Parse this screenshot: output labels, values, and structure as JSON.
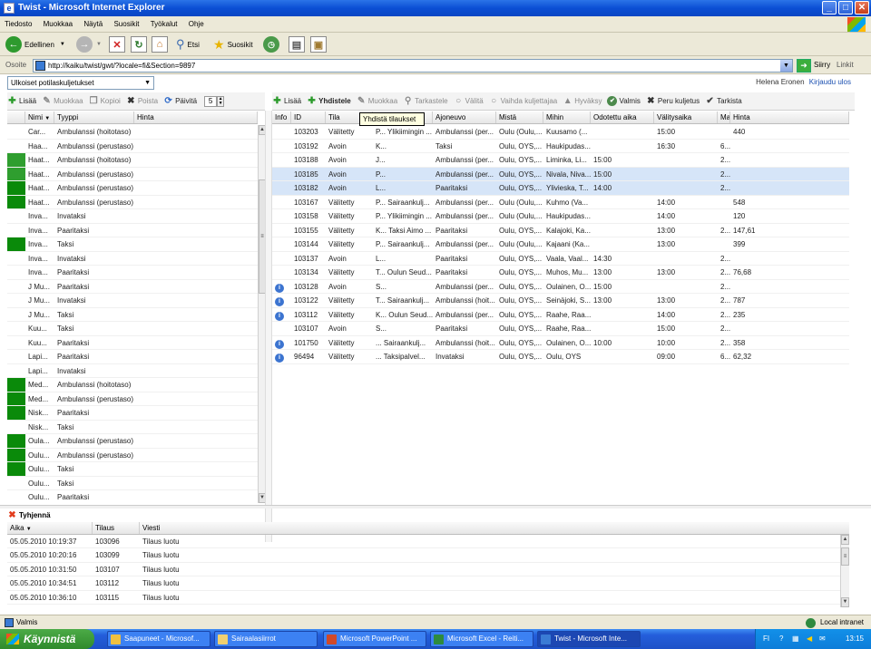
{
  "window": {
    "title": "Twist - Microsoft Internet Explorer",
    "btn_min": "_",
    "btn_max": "□",
    "btn_close": "✕"
  },
  "menu": [
    "Tiedosto",
    "Muokkaa",
    "Näytä",
    "Suosikit",
    "Työkalut",
    "Ohje"
  ],
  "ie_toolbar": {
    "back": "Edellinen",
    "search": "Etsi",
    "favorites": "Suosikit"
  },
  "address": {
    "label": "Osoite",
    "url": "http://kaiku/twist/gwt/?locale=fi&Section=9897",
    "go": "Siirry",
    "links": "Linkit"
  },
  "app": {
    "view_select": "Ulkoiset potilaskuljetukset",
    "user_name": "Helena Eronen",
    "logout": "Kirjaudu ulos",
    "left_toolbar": {
      "add": "Lisää",
      "edit": "Muokkaa",
      "copy": "Kopioi",
      "delete": "Poista",
      "refresh": "Päivitä",
      "refresh_value": "5"
    },
    "right_toolbar": {
      "add": "Lisää",
      "merge": "Yhdistele",
      "edit": "Muokkaa",
      "check": "Tarkastele",
      "broker": "Välitä",
      "change_carrier": "Vaihda kuljettajaa",
      "accept": "Hyväksy",
      "done": "Valmis",
      "cancel": "Peru kuljetus",
      "review": "Tarkista"
    },
    "tooltip": "Yhdistä tilaukset",
    "left_columns": [
      "Nimi",
      "Tyyppi",
      "Hinta"
    ],
    "left_rows": [
      {
        "color": "",
        "name": "Car...",
        "type": "Ambulanssi (hoitotaso)"
      },
      {
        "color": "",
        "name": "Haa...",
        "type": "Ambulanssi (perustaso)"
      },
      {
        "color": "#2f9e2f",
        "name": "Haat...",
        "type": "Ambulanssi (hoitotaso)"
      },
      {
        "color": "#2f9e2f",
        "name": "Haat...",
        "type": "Ambulanssi (perustaso)"
      },
      {
        "color": "#0a8a0a",
        "name": "Haat...",
        "type": "Ambulanssi (perustaso)"
      },
      {
        "color": "#0a8a0a",
        "name": "Haat...",
        "type": "Ambulanssi (perustaso)"
      },
      {
        "color": "",
        "name": "Inva...",
        "type": "Invataksi"
      },
      {
        "color": "",
        "name": "Inva...",
        "type": "Paaritaksi"
      },
      {
        "color": "#0a8a0a",
        "name": "Inva...",
        "type": "Taksi"
      },
      {
        "color": "",
        "name": "Inva...",
        "type": "Invataksi"
      },
      {
        "color": "",
        "name": "Inva...",
        "type": "Paaritaksi"
      },
      {
        "color": "",
        "name": "J Mu...",
        "type": "Paaritaksi"
      },
      {
        "color": "",
        "name": "J Mu...",
        "type": "Invataksi"
      },
      {
        "color": "",
        "name": "J Mu...",
        "type": "Taksi"
      },
      {
        "color": "",
        "name": "Kuu...",
        "type": "Taksi"
      },
      {
        "color": "",
        "name": "Kuu...",
        "type": "Paaritaksi"
      },
      {
        "color": "",
        "name": "Lapi...",
        "type": "Paaritaksi"
      },
      {
        "color": "",
        "name": "Lapi...",
        "type": "Invataksi"
      },
      {
        "color": "#0a8a0a",
        "name": "Med...",
        "type": "Ambulanssi (hoitotaso)"
      },
      {
        "color": "#0a8a0a",
        "name": "Med...",
        "type": "Ambulanssi (perustaso)"
      },
      {
        "color": "#0a8a0a",
        "name": "Nisk...",
        "type": "Paaritaksi"
      },
      {
        "color": "",
        "name": "Nisk...",
        "type": "Taksi"
      },
      {
        "color": "#0a8a0a",
        "name": "Oula...",
        "type": "Ambulanssi (perustaso)"
      },
      {
        "color": "#0a8a0a",
        "name": "Oulu...",
        "type": "Ambulanssi (perustaso)"
      },
      {
        "color": "#0a8a0a",
        "name": "Oulu...",
        "type": "Taksi"
      },
      {
        "color": "",
        "name": "Oulu...",
        "type": "Taksi"
      },
      {
        "color": "",
        "name": "Oulu...",
        "type": "Paaritaksi"
      }
    ],
    "right_columns": [
      "Info",
      "ID",
      "Tila",
      "",
      "Ajoneuvo",
      "Mistä",
      "Mihin",
      "Odotettu aika",
      "Välitysaika",
      "Ma",
      "Hinta"
    ],
    "right_rows": [
      {
        "info": "",
        "id": "103203",
        "state": "Välitetty",
        "carrier": "P... Ylikiimingin ...",
        "vehicle": "Ambulanssi (per...",
        "from": "Oulu (Oulu,...",
        "to": "Kuusamo (...",
        "expected": "",
        "dispatch": "15:00",
        "ma": "",
        "price": "440",
        "sel": false
      },
      {
        "info": "",
        "id": "103192",
        "state": "Avoin",
        "carrier": "K...",
        "vehicle": "Taksi",
        "from": "Oulu, OYS,...",
        "to": "Haukipudas...",
        "expected": "",
        "dispatch": "16:30",
        "ma": "6...",
        "price": "",
        "sel": false
      },
      {
        "info": "",
        "id": "103188",
        "state": "Avoin",
        "carrier": "J...",
        "vehicle": "Ambulanssi (per...",
        "from": "Oulu, OYS,...",
        "to": "Liminka, Li...",
        "expected": "15:00",
        "dispatch": "",
        "ma": "2...",
        "price": "",
        "sel": false
      },
      {
        "info": "",
        "id": "103185",
        "state": "Avoin",
        "carrier": "P...",
        "vehicle": "Ambulanssi (per...",
        "from": "Oulu, OYS,...",
        "to": "Nivala, Niva...",
        "expected": "15:00",
        "dispatch": "",
        "ma": "2...",
        "price": "",
        "sel": true
      },
      {
        "info": "",
        "id": "103182",
        "state": "Avoin",
        "carrier": "L...",
        "vehicle": "Paaritaksi",
        "from": "Oulu, OYS,...",
        "to": "Ylivieska, T...",
        "expected": "14:00",
        "dispatch": "",
        "ma": "2...",
        "price": "",
        "sel": true
      },
      {
        "info": "",
        "id": "103167",
        "state": "Välitetty",
        "carrier": "P... Sairaankulj...",
        "vehicle": "Ambulanssi (per...",
        "from": "Oulu (Oulu,...",
        "to": "Kuhmo (Va...",
        "expected": "",
        "dispatch": "14:00",
        "ma": "",
        "price": "548",
        "sel": false
      },
      {
        "info": "",
        "id": "103158",
        "state": "Välitetty",
        "carrier": "P... Ylikiimingin ...",
        "vehicle": "Ambulanssi (per...",
        "from": "Oulu (Oulu,...",
        "to": "Haukipudas...",
        "expected": "",
        "dispatch": "14:00",
        "ma": "",
        "price": "120",
        "sel": false
      },
      {
        "info": "",
        "id": "103155",
        "state": "Välitetty",
        "carrier": "K... Taksi Aimo ...",
        "vehicle": "Paaritaksi",
        "from": "Oulu, OYS,...",
        "to": "Kalajoki, Ka...",
        "expected": "",
        "dispatch": "13:00",
        "ma": "2...",
        "price": "147,61",
        "sel": false
      },
      {
        "info": "",
        "id": "103144",
        "state": "Välitetty",
        "carrier": "P... Sairaankulj...",
        "vehicle": "Ambulanssi (per...",
        "from": "Oulu (Oulu,...",
        "to": "Kajaani (Ka...",
        "expected": "",
        "dispatch": "13:00",
        "ma": "",
        "price": "399",
        "sel": false
      },
      {
        "info": "",
        "id": "103137",
        "state": "Avoin",
        "carrier": "L...",
        "vehicle": "Paaritaksi",
        "from": "Oulu, OYS,...",
        "to": "Vaala, Vaal...",
        "expected": "14:30",
        "dispatch": "",
        "ma": "2...",
        "price": "",
        "sel": false
      },
      {
        "info": "",
        "id": "103134",
        "state": "Välitetty",
        "carrier": "T... Oulun Seud...",
        "vehicle": "Paaritaksi",
        "from": "Oulu, OYS,...",
        "to": "Muhos, Mu...",
        "expected": "13:00",
        "dispatch": "13:00",
        "ma": "2...",
        "price": "76,68",
        "sel": false
      },
      {
        "info": "i",
        "id": "103128",
        "state": "Avoin",
        "carrier": "S...",
        "vehicle": "Ambulanssi (per...",
        "from": "Oulu, OYS,...",
        "to": "Oulainen, O...",
        "expected": "15:00",
        "dispatch": "",
        "ma": "2...",
        "price": "",
        "sel": false
      },
      {
        "info": "i",
        "id": "103122",
        "state": "Välitetty",
        "carrier": "T... Sairaankulj...",
        "vehicle": "Ambulanssi (hoit...",
        "from": "Oulu, OYS,...",
        "to": "Seinäjoki, S...",
        "expected": "13:00",
        "dispatch": "13:00",
        "ma": "2...",
        "price": "787",
        "sel": false
      },
      {
        "info": "i",
        "id": "103112",
        "state": "Välitetty",
        "carrier": "K... Oulun Seud...",
        "vehicle": "Ambulanssi (per...",
        "from": "Oulu, OYS,...",
        "to": "Raahe, Raa...",
        "expected": "",
        "dispatch": "14:00",
        "ma": "2...",
        "price": "235",
        "sel": false
      },
      {
        "info": "",
        "id": "103107",
        "state": "Avoin",
        "carrier": "S...",
        "vehicle": "Paaritaksi",
        "from": "Oulu, OYS,...",
        "to": "Raahe, Raa...",
        "expected": "",
        "dispatch": "15:00",
        "ma": "2...",
        "price": "",
        "sel": false
      },
      {
        "info": "i",
        "id": "101750",
        "state": "Välitetty",
        "carrier": "... Sairaankulj...",
        "vehicle": "Ambulanssi (hoit...",
        "from": "Oulu, OYS,...",
        "to": "Oulainen, O...",
        "expected": "10:00",
        "dispatch": "10:00",
        "ma": "2...",
        "price": "358",
        "sel": false
      },
      {
        "info": "i",
        "id": "96494",
        "state": "Välitetty",
        "carrier": "... Taksipalvel...",
        "vehicle": "Invataksi",
        "from": "Oulu, OYS,...",
        "to": "Oulu, OYS",
        "expected": "",
        "dispatch": "09:00",
        "ma": "6...",
        "price": "62,32",
        "sel": false
      }
    ],
    "log": {
      "clear": "Tyhjennä",
      "columns": [
        "Aika",
        "Tilaus",
        "Viesti"
      ],
      "rows": [
        {
          "time": "05.05.2010 10:19:37",
          "order": "103096",
          "msg": "Tilaus luotu"
        },
        {
          "time": "05.05.2010 10:20:16",
          "order": "103099",
          "msg": "Tilaus luotu"
        },
        {
          "time": "05.05.2010 10:31:50",
          "order": "103107",
          "msg": "Tilaus luotu"
        },
        {
          "time": "05.05.2010 10:34:51",
          "order": "103112",
          "msg": "Tilaus luotu"
        },
        {
          "time": "05.05.2010 10:36:10",
          "order": "103115",
          "msg": "Tilaus luotu"
        }
      ]
    }
  },
  "status": {
    "left": "Valmis",
    "zone": "Local intranet"
  },
  "taskbar": {
    "start": "Käynnistä",
    "tasks": [
      {
        "label": "Saapuneet - Microsof...",
        "color": "#f0c040"
      },
      {
        "label": "Sairaalasiirrot",
        "color": "#f0d070"
      },
      {
        "label": "Microsoft PowerPoint ...",
        "color": "#d0492a"
      },
      {
        "label": "Microsoft Excel - Reiti...",
        "color": "#2e8b3e"
      },
      {
        "label": "Twist - Microsoft Inte...",
        "color": "#3a7bd5"
      }
    ],
    "lang": "FI",
    "clock": "13:15"
  }
}
